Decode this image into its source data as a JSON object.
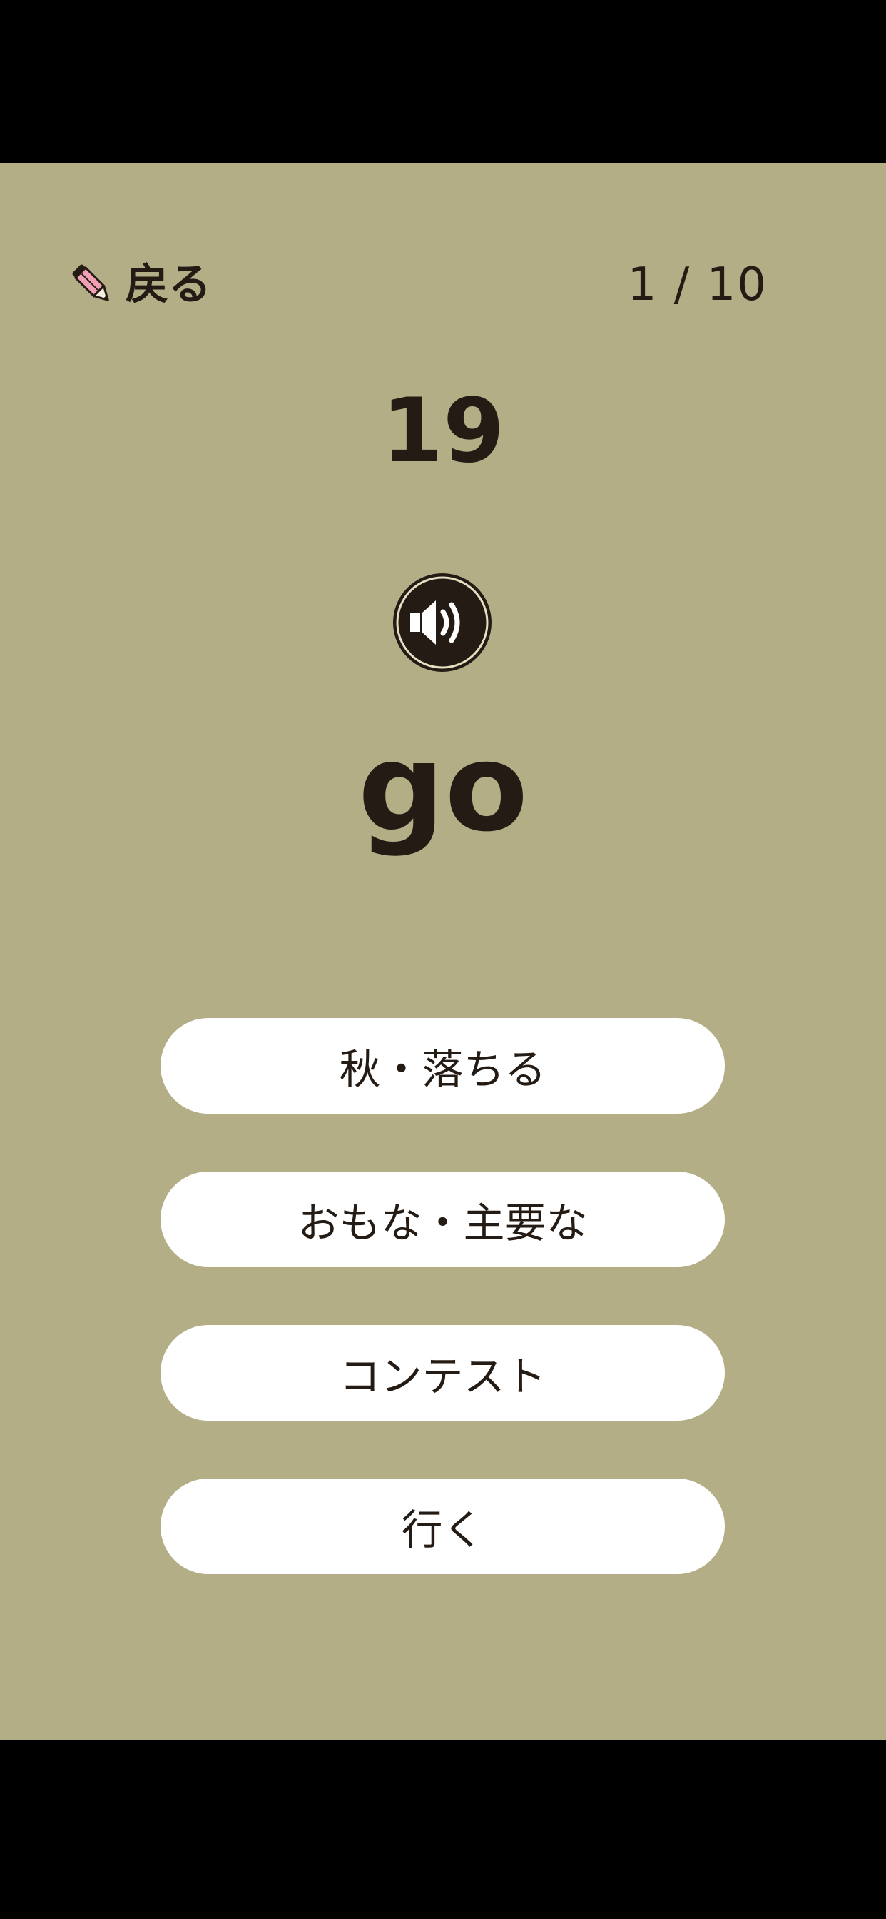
{
  "header": {
    "back_label": "戻る",
    "back_icon": "pencil-icon",
    "progress": "1 / 10"
  },
  "question": {
    "number": "19",
    "word": "go",
    "audio_icon": "speaker-icon"
  },
  "choices": [
    {
      "label": "秋・落ちる"
    },
    {
      "label": "おもな・主要な"
    },
    {
      "label": "コンテスト"
    },
    {
      "label": "行く"
    }
  ],
  "colors": {
    "background": "#b4ae86",
    "text": "#241b14",
    "button": "#ffffff",
    "pencil_body": "#f0a0b4"
  }
}
